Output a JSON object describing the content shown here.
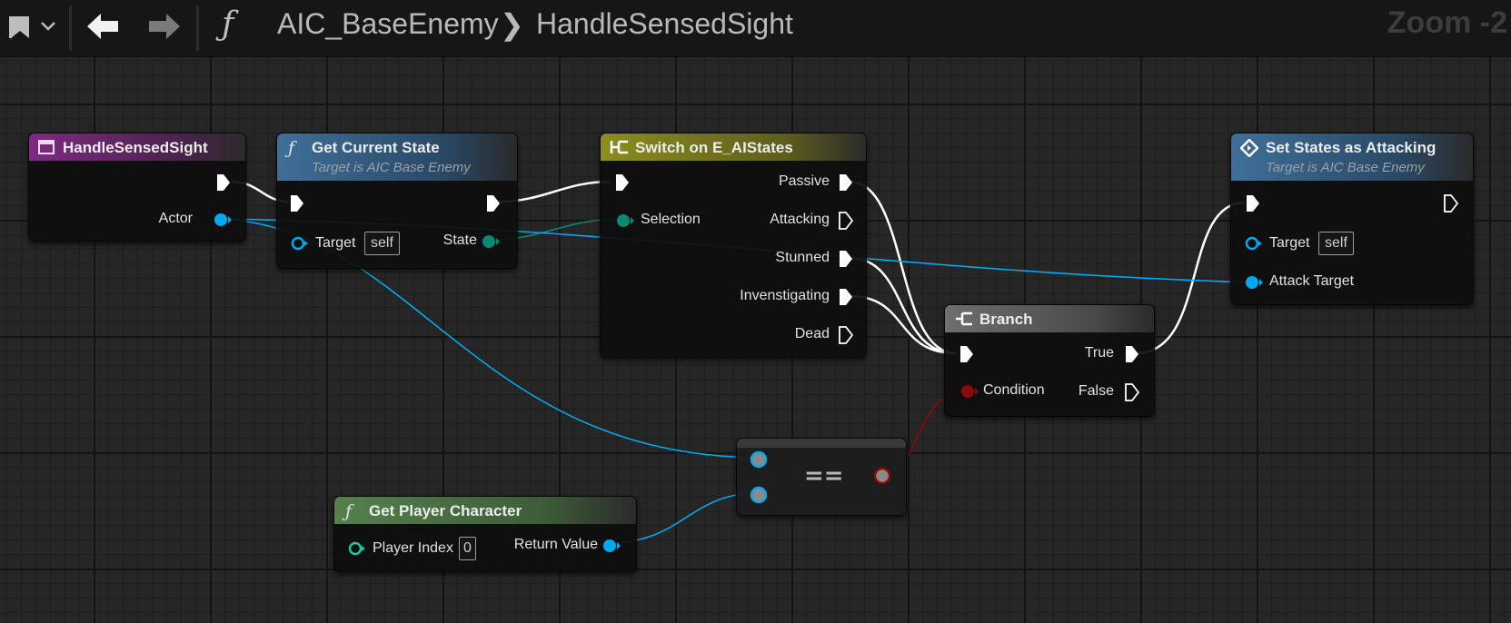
{
  "toolbar": {
    "breadcrumb_root": "AIC_BaseEnemy",
    "breadcrumb_separator": "❯",
    "breadcrumb_function": "HandleSensedSight",
    "zoom": "Zoom -2",
    "icons": [
      "bookmark-icon",
      "chevron-down-icon",
      "back-arrow-icon",
      "forward-arrow-icon",
      "function-icon"
    ]
  },
  "nodes": {
    "handle_sensed_sight": {
      "title": "HandleSensedSight",
      "pin_actor": "Actor"
    },
    "get_current_state": {
      "title": "Get Current State",
      "subtitle": "Target is AIC Base Enemy",
      "pin_target": "Target",
      "target_value": "self",
      "pin_state": "State"
    },
    "switch_states": {
      "title": "Switch on E_AIStates",
      "pin_selection": "Selection",
      "out_passive": "Passive",
      "out_attacking": "Attacking",
      "out_stunned": "Stunned",
      "out_investigating": "Invenstigating",
      "out_dead": "Dead"
    },
    "branch": {
      "title": "Branch",
      "pin_condition": "Condition",
      "out_true": "True",
      "out_false": "False"
    },
    "set_states_attacking": {
      "title": "Set States as Attacking",
      "subtitle": "Target is AIC Base Enemy",
      "pin_target": "Target",
      "target_value": "self",
      "pin_attack_target": "Attack Target"
    },
    "equal": {
      "symbol": "=="
    },
    "get_player_character": {
      "title": "Get Player Character",
      "pin_player_index": "Player Index",
      "player_index_value": "0",
      "pin_return": "Return Value"
    }
  },
  "colors": {
    "exec_wire": "#ffffff",
    "object_pin": "#00a8f0",
    "enum_pin": "#0a8a72",
    "bool_pin": "#8c0a0a",
    "event_header": "#8a2d8c",
    "function_header": "#2d5a80",
    "pure_header": "#4a7044",
    "switch_header": "#8a8a1e",
    "branch_header": "#6a6a6a"
  }
}
